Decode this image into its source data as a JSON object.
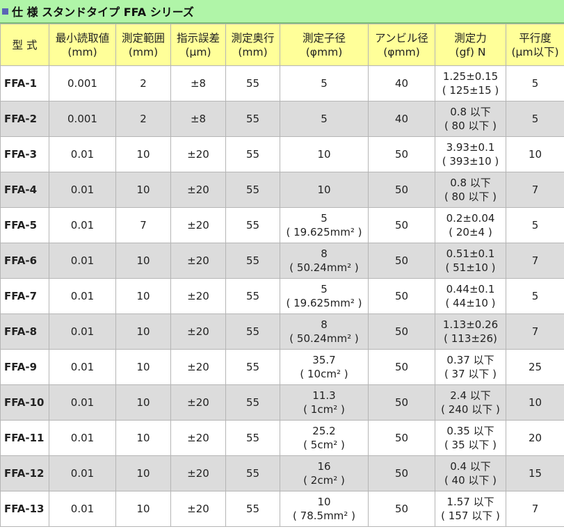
{
  "title": "仕 様 スタンドタイプ FFA シリーズ",
  "title_icon": "square-bullet-icon",
  "colors": {
    "title_bg": "#b0f5a8",
    "header_bg": "#ffff99",
    "row_alt_bg": "#dcdcdc",
    "bullet": "#5a64b5"
  },
  "headers": [
    [
      "型 式"
    ],
    [
      "最小読取値",
      "(mm)"
    ],
    [
      "測定範囲",
      "(mm)"
    ],
    [
      "指示誤差",
      "(µm)"
    ],
    [
      "測定奥行",
      "(mm)"
    ],
    [
      "測定子径",
      "(φmm)"
    ],
    [
      "アンビル径",
      "(φmm)"
    ],
    [
      "測定力",
      "(gf) N"
    ],
    [
      "平行度",
      "(µm以下)"
    ]
  ],
  "rows": [
    [
      [
        "FFA-1"
      ],
      [
        "0.001"
      ],
      [
        "2"
      ],
      [
        "±8"
      ],
      [
        "55"
      ],
      [
        "5"
      ],
      [
        "40"
      ],
      [
        "1.25±0.15",
        "( 125±15 )"
      ],
      [
        "5"
      ]
    ],
    [
      [
        "FFA-2"
      ],
      [
        "0.001"
      ],
      [
        "2"
      ],
      [
        "±8"
      ],
      [
        "55"
      ],
      [
        "5"
      ],
      [
        "40"
      ],
      [
        "0.8 以下",
        "( 80 以下 )"
      ],
      [
        "5"
      ]
    ],
    [
      [
        "FFA-3"
      ],
      [
        "0.01"
      ],
      [
        "10"
      ],
      [
        "±20"
      ],
      [
        "55"
      ],
      [
        "10"
      ],
      [
        "50"
      ],
      [
        "3.93±0.1",
        "( 393±10 )"
      ],
      [
        "10"
      ]
    ],
    [
      [
        "FFA-4"
      ],
      [
        "0.01"
      ],
      [
        "10"
      ],
      [
        "±20"
      ],
      [
        "55"
      ],
      [
        "10"
      ],
      [
        "50"
      ],
      [
        "0.8 以下",
        "( 80 以下 )"
      ],
      [
        "7"
      ]
    ],
    [
      [
        "FFA-5"
      ],
      [
        "0.01"
      ],
      [
        "7"
      ],
      [
        "±20"
      ],
      [
        "55"
      ],
      [
        "5",
        "( 19.625mm² )"
      ],
      [
        "50"
      ],
      [
        "0.2±0.04",
        "( 20±4 )"
      ],
      [
        "5"
      ]
    ],
    [
      [
        "FFA-6"
      ],
      [
        "0.01"
      ],
      [
        "10"
      ],
      [
        "±20"
      ],
      [
        "55"
      ],
      [
        "8",
        "( 50.24mm² )"
      ],
      [
        "50"
      ],
      [
        "0.51±0.1",
        "( 51±10 )"
      ],
      [
        "7"
      ]
    ],
    [
      [
        "FFA-7"
      ],
      [
        "0.01"
      ],
      [
        "10"
      ],
      [
        "±20"
      ],
      [
        "55"
      ],
      [
        "5",
        "( 19.625mm² )"
      ],
      [
        "50"
      ],
      [
        "0.44±0.1",
        "( 44±10 )"
      ],
      [
        "5"
      ]
    ],
    [
      [
        "FFA-8"
      ],
      [
        "0.01"
      ],
      [
        "10"
      ],
      [
        "±20"
      ],
      [
        "55"
      ],
      [
        "8",
        "( 50.24mm² )"
      ],
      [
        "50"
      ],
      [
        "1.13±0.26",
        "( 113±26)"
      ],
      [
        "7"
      ]
    ],
    [
      [
        "FFA-9"
      ],
      [
        "0.01"
      ],
      [
        "10"
      ],
      [
        "±20"
      ],
      [
        "55"
      ],
      [
        "35.7",
        "( 10cm² )"
      ],
      [
        "50"
      ],
      [
        "0.37 以下",
        "( 37 以下 )"
      ],
      [
        "25"
      ]
    ],
    [
      [
        "FFA-10"
      ],
      [
        "0.01"
      ],
      [
        "10"
      ],
      [
        "±20"
      ],
      [
        "55"
      ],
      [
        "11.3",
        "( 1cm² )"
      ],
      [
        "50"
      ],
      [
        "2.4 以下",
        "( 240 以下 )"
      ],
      [
        "10"
      ]
    ],
    [
      [
        "FFA-11"
      ],
      [
        "0.01"
      ],
      [
        "10"
      ],
      [
        "±20"
      ],
      [
        "55"
      ],
      [
        "25.2",
        "( 5cm² )"
      ],
      [
        "50"
      ],
      [
        "0.35 以下",
        "( 35 以下 )"
      ],
      [
        "20"
      ]
    ],
    [
      [
        "FFA-12"
      ],
      [
        "0.01"
      ],
      [
        "10"
      ],
      [
        "±20"
      ],
      [
        "55"
      ],
      [
        "16",
        "( 2cm² )"
      ],
      [
        "50"
      ],
      [
        "0.4 以下",
        "( 40 以下 )"
      ],
      [
        "15"
      ]
    ],
    [
      [
        "FFA-13"
      ],
      [
        "0.01"
      ],
      [
        "10"
      ],
      [
        "±20"
      ],
      [
        "55"
      ],
      [
        "10",
        "( 78.5mm² )"
      ],
      [
        "50"
      ],
      [
        "1.57 以下",
        "( 157 以下 )"
      ],
      [
        "7"
      ]
    ]
  ]
}
